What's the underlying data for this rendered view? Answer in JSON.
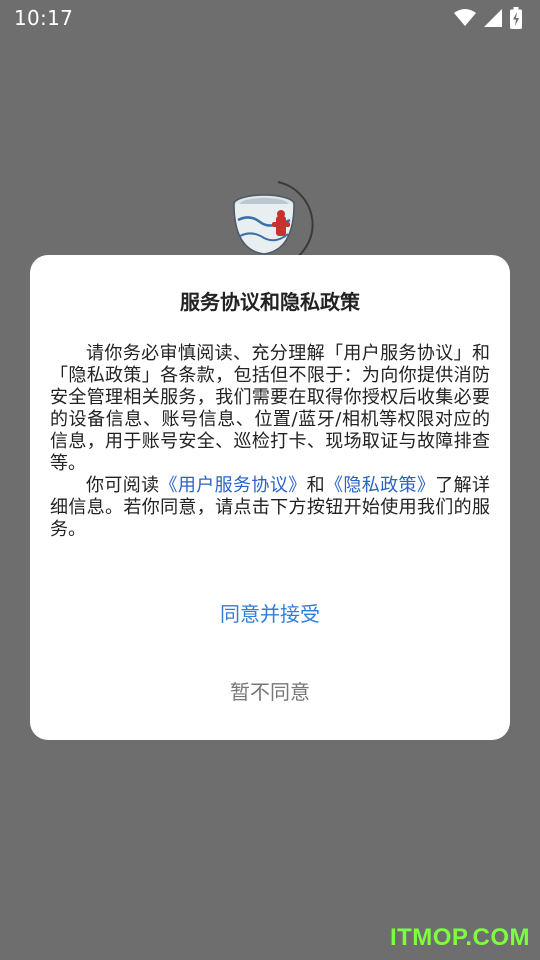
{
  "status_bar": {
    "time": "10:17",
    "icons": [
      "wifi-icon",
      "cell-signal-icon",
      "battery-charging-icon"
    ]
  },
  "background": {
    "logo_icon": "fire-hydrant-bowl-logo-icon"
  },
  "dialog": {
    "title": "服务协议和隐私政策",
    "paragraph1": "请你务必审慎阅读、充分理解「用户服务协议」和「隐私政策」各条款，包括但不限于：为向你提供消防安全管理相关服务，我们需要在取得你授权后收集必要的设备信息、账号信息、位置/蓝牙/相机等权限对应的信息，用于账号安全、巡检打卡、现场取证与故障排查等。",
    "paragraph2_prefix": "你可阅读",
    "user_agreement_link": "《用户服务协议》",
    "and_text": "和",
    "privacy_policy_link": "《隐私政策》",
    "paragraph2_suffix": "了解详细信息。若你同意，请点击下方按钮开始使用我们的服务。",
    "accept_button": "同意并接受",
    "decline_button": "暂不同意"
  },
  "watermark": "ITMOP.COM",
  "colors": {
    "overlay": "#6e6e6e",
    "link": "#2a63c7",
    "accept": "#2f7fd6",
    "decline": "#777777",
    "watermark": "#7dff3e"
  }
}
